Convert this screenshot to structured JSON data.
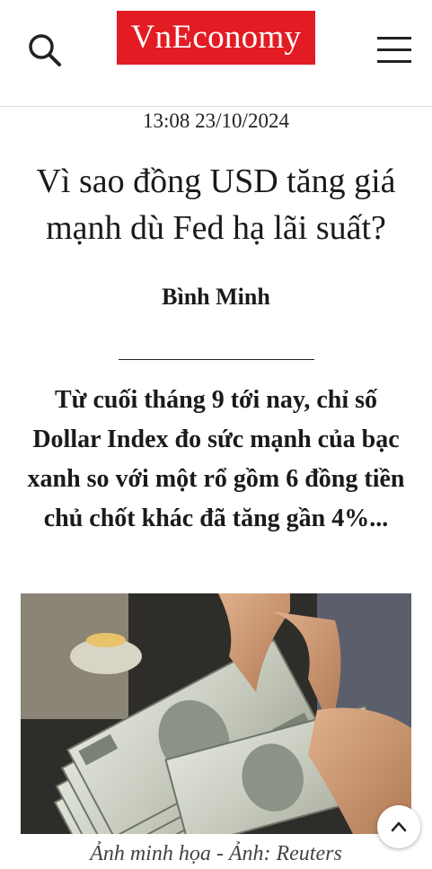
{
  "header": {
    "logo_text": "VnEconomy",
    "search_icon": "search-icon",
    "menu_icon": "hamburger-menu-icon"
  },
  "article": {
    "timestamp": "13:08 23/10/2024",
    "title": "Vì sao đồng USD tăng giá mạnh dù Fed hạ lãi suất?",
    "author": "Bình Minh",
    "sapo": "Từ cuối tháng 9 tới nay, chỉ số Dollar Index đo sức mạnh của bạc xanh so với một rổ gồm 6 đồng tiền chủ chốt khác đã tăng gần 4%...",
    "image_caption": "Ảnh minh họa - Ảnh: Reuters"
  },
  "floating": {
    "scroll_top_icon": "chevron-up-icon"
  },
  "colors": {
    "brand_red": "#e31b23",
    "text": "#1a1a1a"
  }
}
